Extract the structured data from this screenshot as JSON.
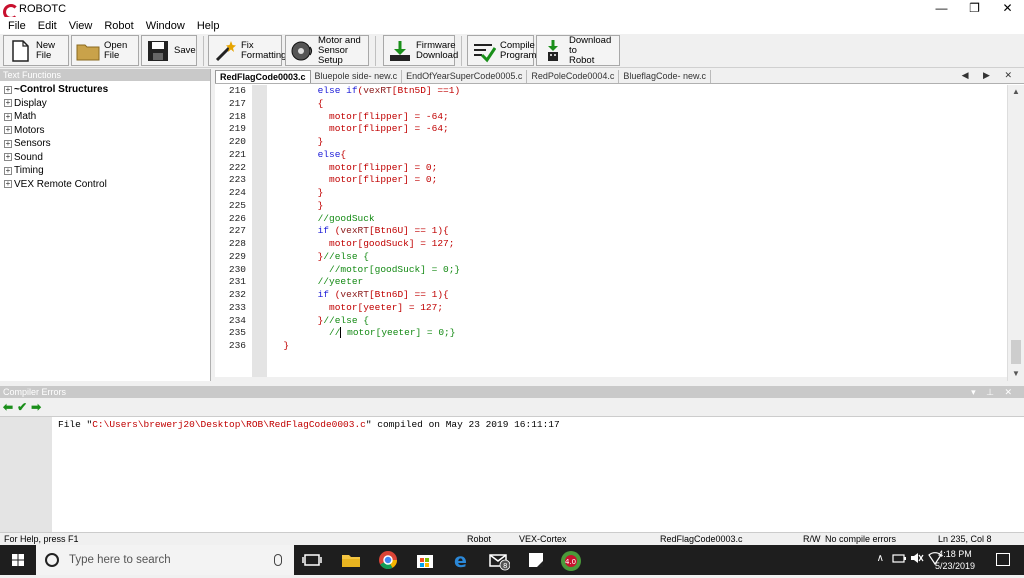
{
  "window": {
    "title": "ROBOTC",
    "controls": [
      "—",
      "❐",
      "✕"
    ]
  },
  "menu": [
    "File",
    "Edit",
    "View",
    "Robot",
    "Window",
    "Help"
  ],
  "toolbar": {
    "new_file": "New File",
    "open_file": "Open File",
    "save": "Save",
    "fix_formatting_1": "Fix",
    "fix_formatting_2": "Formatting",
    "motor_sensor_1": "Motor and",
    "motor_sensor_2": "Sensor Setup",
    "firmware_1": "Firmware",
    "firmware_2": "Download",
    "compile_1": "Compile",
    "compile_2": "Program",
    "download_1": "Download to",
    "download_2": "Robot"
  },
  "text_functions": {
    "header": "Text Functions",
    "items": [
      "~Control Structures",
      "Display",
      "Math",
      "Motors",
      "Sensors",
      "Sound",
      "Timing",
      "VEX Remote Control"
    ]
  },
  "tabs": [
    "RedFlagCode0003.c",
    "Bluepole side- new.c",
    "EndOfYearSuperCode0005.c",
    "RedPoleCode0004.c",
    "BlueflagCode- new.c"
  ],
  "tab_nav": "◀ ▶ ✕",
  "line_numbers": [
    "216",
    "217",
    "218",
    "219",
    "220",
    "221",
    "222",
    "223",
    "224",
    "225",
    "226",
    "227",
    "228",
    "229",
    "230",
    "231",
    "232",
    "233",
    "234",
    "235",
    "236"
  ],
  "code": {
    "l216a": "        ",
    "l216b": "else if",
    "l216c": "(",
    "l216d": "vexRT",
    "l216e": "[Btn5D] ==1)",
    "l217": "        {",
    "l218": "          motor[flipper] = -64;",
    "l219": "          motor[flipper] = -64;",
    "l220": "        }",
    "l221a": "        ",
    "l221b": "else",
    "l221c": "{",
    "l222": "          motor[flipper] = 0;",
    "l223": "          motor[flipper] = 0;",
    "l224": "        }",
    "l225": "        }",
    "l226a": "        ",
    "l226b": "//goodSuck",
    "l227a": "        ",
    "l227b": "if",
    "l227c": " (",
    "l227d": "vexRT",
    "l227e": "[Btn6U] == 1){",
    "l228": "          motor[goodSuck] = 127;",
    "l229a": "        }",
    "l229b": "//else {",
    "l230a": "          ",
    "l230b": "//motor[goodSuck] = 0;}",
    "l231a": "        ",
    "l231b": "//yeeter",
    "l232a": "        ",
    "l232b": "if",
    "l232c": " (",
    "l232d": "vexRT",
    "l232e": "[Btn6D] == 1){",
    "l233": "          motor[yeeter] = 127;",
    "l234a": "        }",
    "l234b": "//else {",
    "l235a": "          //",
    "l235b": " motor[yeeter] = 0;}",
    "l236": "  }"
  },
  "compiler": {
    "header": "Compiler Errors",
    "pins": "▾ ⊥ ✕",
    "msg_prefix": "File \"",
    "msg_path": "C:\\Users\\brewerj20\\Desktop\\ROB\\RedFlagCode0003.c",
    "msg_suffix": "\" compiled on May 23 2019 16:11:17"
  },
  "status": {
    "help": "For Help, press F1",
    "robot": "Robot",
    "platform": "VEX-Cortex",
    "file": "RedFlagCode0003.c",
    "rw": "R/W",
    "errors": "No compile errors",
    "position": "Ln 235, Col 8"
  },
  "taskbar": {
    "search_placeholder": "Type here to search",
    "time": "4:18 PM",
    "date": "5/23/2019",
    "mail_badge": "8"
  },
  "colors": {
    "keyword": "#1c1cd8",
    "comment": "#148a14",
    "code_text": "#c00000",
    "accent_green": "#1a8f1a"
  }
}
